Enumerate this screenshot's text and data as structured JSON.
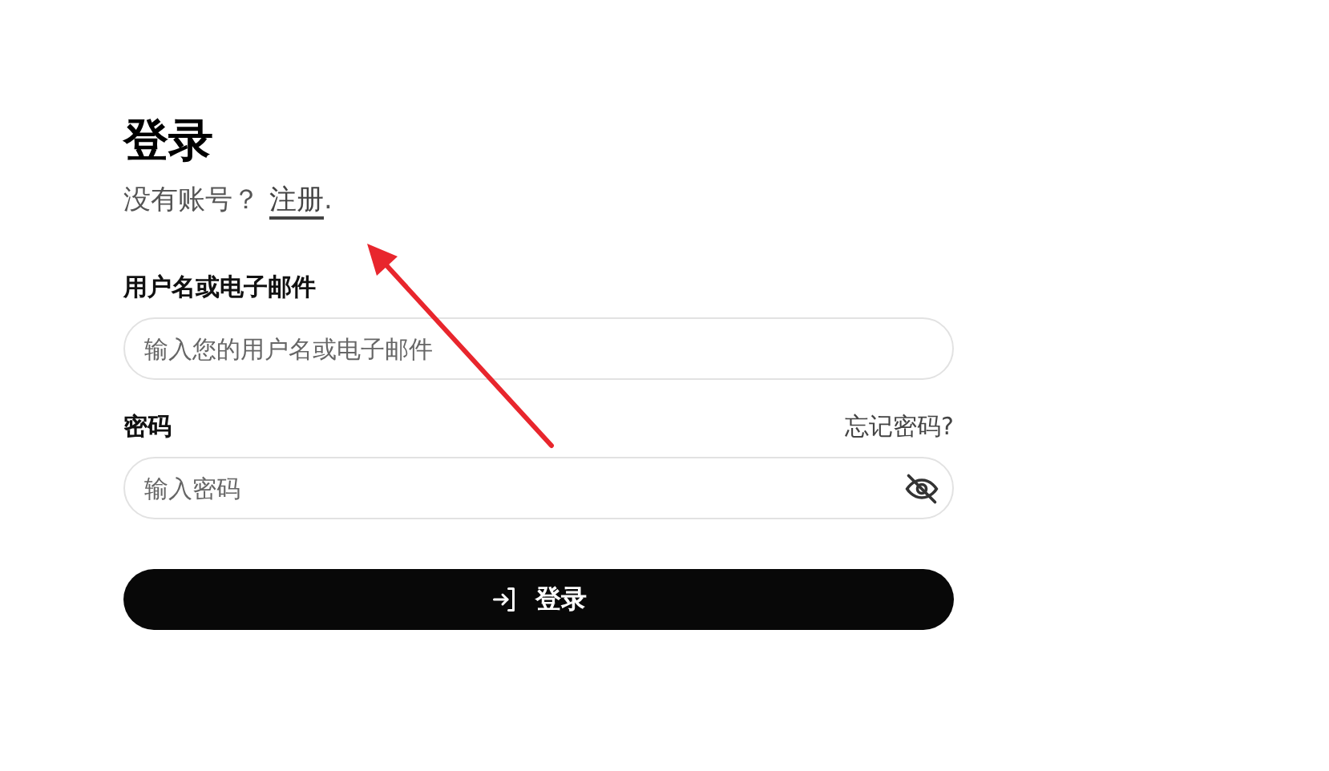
{
  "title": "登录",
  "signup": {
    "prompt": "没有账号？",
    "link": "注册",
    "suffix": "."
  },
  "fields": [
    {
      "label": "用户名或电子邮件",
      "placeholder": "输入您的用户名或电子邮件",
      "kind": "text"
    },
    {
      "label": "密码",
      "placeholder": "输入密码",
      "kind": "password",
      "aside_link": "忘记密码?"
    }
  ],
  "submit": {
    "label": "登录"
  },
  "annotation": {
    "kind": "arrow",
    "color": "#e8262d"
  }
}
